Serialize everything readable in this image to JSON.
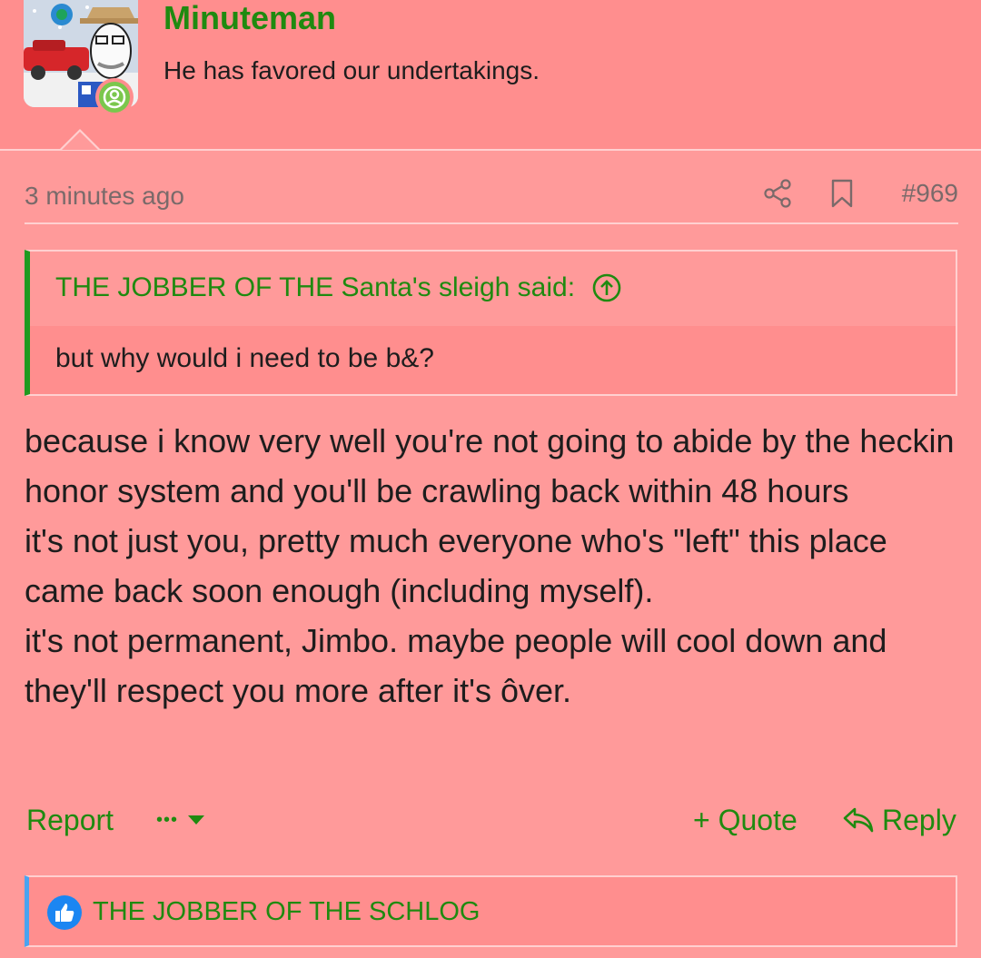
{
  "user": {
    "name": "Minuteman",
    "title": "He has favored our undertakings."
  },
  "post": {
    "timestamp": "3 minutes ago",
    "number": "#969",
    "quote": {
      "author_line": "THE JOBBER OF THE Santa's sleigh said:",
      "text": "but why would i need to be b&?"
    },
    "message_lines": [
      "because i know very well you're not going to abide by the heckin honor system and you'll be crawling back within 48 hours",
      "it's not just you, pretty much everyone who's \"left\" this place came back soon enough (including myself).",
      "it's not permanent, Jimbo. maybe people will cool down and they'll respect you more after it's ôver."
    ]
  },
  "actions": {
    "report": "Report",
    "more": "•••",
    "quote": "+ Quote",
    "reply": "Reply"
  },
  "reactions": {
    "users": "THE JOBBER OF THE SCHLOG",
    "icon": "thumbs-up-icon"
  },
  "colors": {
    "background": "#ff9a9a",
    "header": "#ff8e8e",
    "accent_green": "#1f8a10",
    "reaction_blue": "#1b86f2"
  }
}
